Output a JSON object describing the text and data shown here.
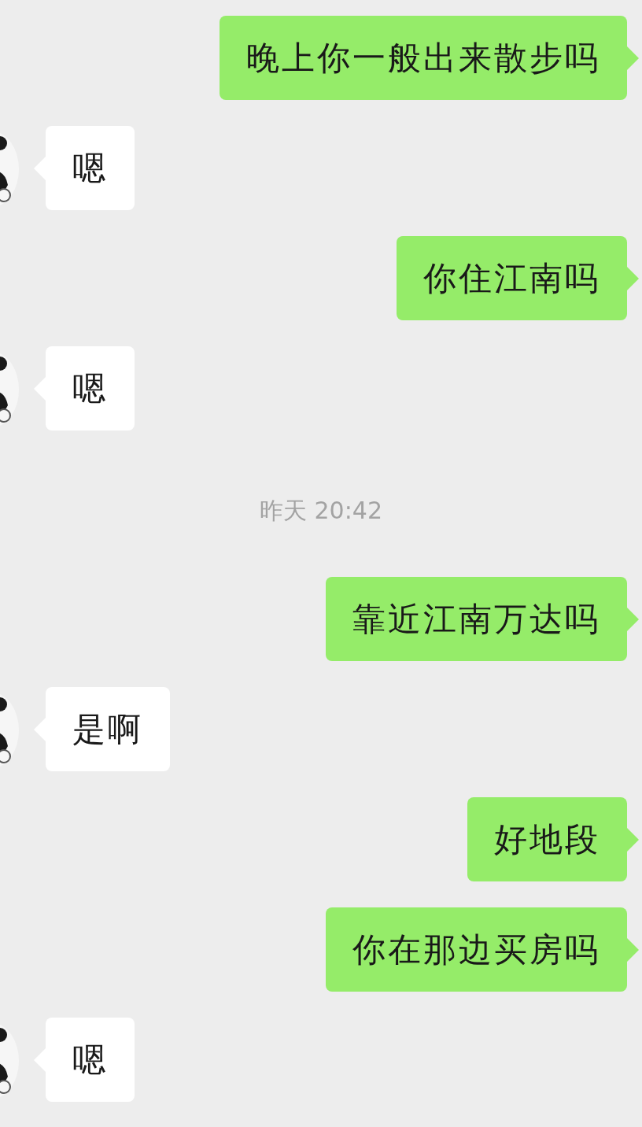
{
  "messages": [
    {
      "kind": "sent",
      "text": "晚上你一般出来散步吗"
    },
    {
      "kind": "received",
      "text": "嗯"
    },
    {
      "kind": "sent",
      "text": "你住江南吗"
    },
    {
      "kind": "received",
      "text": "嗯"
    },
    {
      "kind": "time",
      "text": "昨天 20:42"
    },
    {
      "kind": "sent",
      "text": "靠近江南万达吗"
    },
    {
      "kind": "received",
      "text": "是啊"
    },
    {
      "kind": "sent",
      "text": "好地段"
    },
    {
      "kind": "sent",
      "text": "你在那边买房吗"
    },
    {
      "kind": "received",
      "text": "嗯"
    }
  ]
}
